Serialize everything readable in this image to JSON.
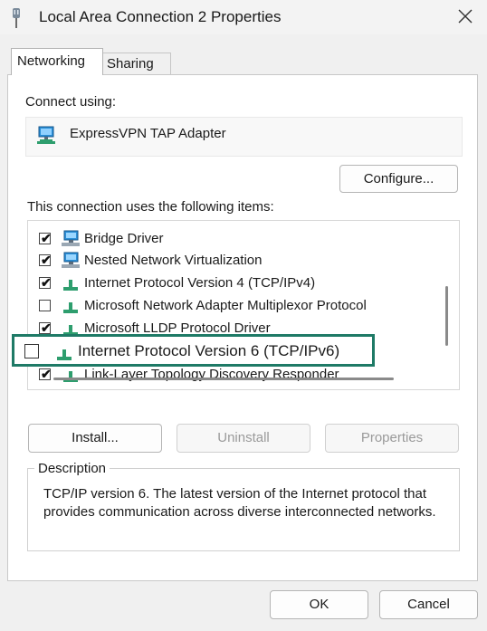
{
  "window": {
    "title": "Local Area Connection 2 Properties"
  },
  "tabs": [
    {
      "label": "Networking",
      "selected": true
    },
    {
      "label": "Sharing",
      "selected": false
    }
  ],
  "connect_using": {
    "label": "Connect using:",
    "adapter": "ExpressVPN TAP Adapter",
    "configure_button": "Configure..."
  },
  "items_section": {
    "label": "This connection uses the following items:",
    "items": [
      {
        "label": "Bridge Driver",
        "checked": true,
        "icon": "network-computer-icon"
      },
      {
        "label": "Nested Network Virtualization",
        "checked": true,
        "icon": "network-computer-icon"
      },
      {
        "label": "Internet Protocol Version 4 (TCP/IPv4)",
        "checked": true,
        "icon": "protocol-icon"
      },
      {
        "label": "Microsoft Network Adapter Multiplexor Protocol",
        "checked": false,
        "icon": "protocol-icon"
      },
      {
        "label": "Microsoft LLDP Protocol Driver",
        "checked": true,
        "icon": "protocol-icon"
      },
      {
        "label": "Internet Protocol Version 6 (TCP/IPv6)",
        "checked": false,
        "icon": "protocol-icon",
        "highlighted": true
      },
      {
        "label": "Link-Layer Topology Discovery Responder",
        "checked": true,
        "icon": "protocol-icon"
      }
    ]
  },
  "buttons": {
    "install": "Install...",
    "uninstall": "Uninstall",
    "properties": "Properties",
    "ok": "OK",
    "cancel": "Cancel"
  },
  "description": {
    "legend": "Description",
    "text": "TCP/IP version 6. The latest version of the Internet protocol that provides communication across diverse interconnected networks."
  },
  "colors": {
    "highlight_border": "#1e7a66",
    "protocol_icon": "#2e9e6e",
    "network_icon": "#1f7fd1"
  }
}
